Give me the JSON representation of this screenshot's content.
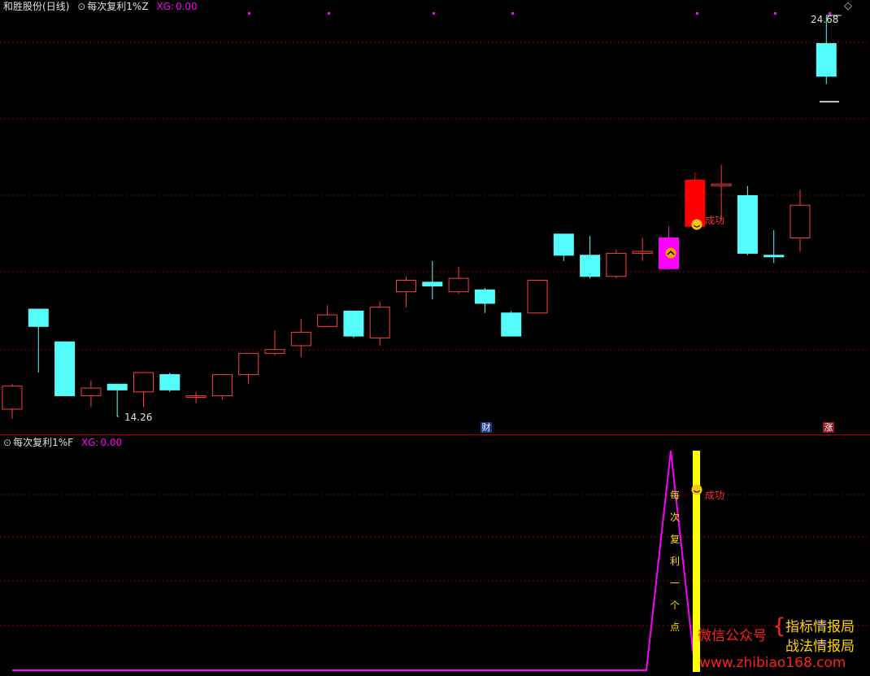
{
  "header": {
    "stock": "和胜股份",
    "period": "(日线)",
    "indicator": "每次复利1%Z",
    "xg_label": "XG:",
    "xg_value": "0.00"
  },
  "sub_header": {
    "indicator": "每次复利1%F",
    "xg_label": "XG:",
    "xg_value": "0.00"
  },
  "price_labels": {
    "high": "24.68",
    "low": "14.26"
  },
  "badges": {
    "cai": "财",
    "zhang": "涨"
  },
  "signals": {
    "success_main": "成功",
    "success_sub": "成功"
  },
  "vertical_text": [
    "每",
    "次",
    "复",
    "利",
    "一",
    "个",
    "点"
  ],
  "watermark": {
    "wechat": "微信公众号",
    "brace": "{",
    "name1": "指标情报局",
    "name2": "战法情报局",
    "url": "www.zhibiao168.com"
  },
  "colors": {
    "up": "#ff3c3c",
    "down": "#54fcfc",
    "grid": "#8c0000",
    "magenta": "#ff00ff",
    "yellow": "#ffff00",
    "signal_red": "#ff0000"
  },
  "chart_data": {
    "type": "candlestick",
    "y_high": 24.68,
    "y_low": 14.26,
    "candles": [
      {
        "o": 14.45,
        "h": 15.1,
        "l": 14.2,
        "c": 15.05,
        "color": "up"
      },
      {
        "o": 17.05,
        "h": 17.05,
        "l": 15.4,
        "c": 16.6,
        "color": "down"
      },
      {
        "o": 16.2,
        "h": 16.2,
        "l": 14.8,
        "c": 14.8,
        "color": "down"
      },
      {
        "o": 14.8,
        "h": 15.2,
        "l": 14.5,
        "c": 15.0,
        "color": "up"
      },
      {
        "o": 15.1,
        "h": 15.1,
        "l": 14.26,
        "c": 14.95,
        "color": "down"
      },
      {
        "o": 14.9,
        "h": 15.4,
        "l": 14.5,
        "c": 15.4,
        "color": "up"
      },
      {
        "o": 15.35,
        "h": 15.4,
        "l": 14.9,
        "c": 14.95,
        "color": "down"
      },
      {
        "o": 14.8,
        "h": 14.9,
        "l": 14.6,
        "c": 14.8,
        "color": "up"
      },
      {
        "o": 14.8,
        "h": 15.35,
        "l": 14.7,
        "c": 15.35,
        "color": "up"
      },
      {
        "o": 15.35,
        "h": 15.9,
        "l": 15.1,
        "c": 15.9,
        "color": "up"
      },
      {
        "o": 15.9,
        "h": 16.5,
        "l": 15.85,
        "c": 16.0,
        "color": "up"
      },
      {
        "o": 16.1,
        "h": 16.8,
        "l": 15.8,
        "c": 16.45,
        "color": "up"
      },
      {
        "o": 16.6,
        "h": 17.15,
        "l": 16.6,
        "c": 16.9,
        "color": "up"
      },
      {
        "o": 17.0,
        "h": 17.0,
        "l": 16.3,
        "c": 16.35,
        "color": "down"
      },
      {
        "o": 16.3,
        "h": 17.25,
        "l": 16.1,
        "c": 17.1,
        "color": "up"
      },
      {
        "o": 17.5,
        "h": 17.9,
        "l": 17.1,
        "c": 17.8,
        "color": "up"
      },
      {
        "o": 17.75,
        "h": 18.3,
        "l": 17.3,
        "c": 17.65,
        "color": "down"
      },
      {
        "o": 17.5,
        "h": 18.15,
        "l": 17.45,
        "c": 17.85,
        "color": "up"
      },
      {
        "o": 17.55,
        "h": 17.6,
        "l": 16.95,
        "c": 17.2,
        "color": "down"
      },
      {
        "o": 16.95,
        "h": 17.0,
        "l": 16.35,
        "c": 16.35,
        "color": "down"
      },
      {
        "o": 16.95,
        "h": 17.8,
        "l": 16.95,
        "c": 17.8,
        "color": "up"
      },
      {
        "o": 19.0,
        "h": 19.0,
        "l": 18.3,
        "c": 18.45,
        "color": "down"
      },
      {
        "o": 18.45,
        "h": 18.95,
        "l": 17.85,
        "c": 17.9,
        "color": "down"
      },
      {
        "o": 17.9,
        "h": 18.6,
        "l": 17.85,
        "c": 18.5,
        "color": "up"
      },
      {
        "o": 18.5,
        "h": 18.9,
        "l": 18.3,
        "c": 18.55,
        "color": "up"
      },
      {
        "o": 18.9,
        "h": 19.2,
        "l": 18.1,
        "c": 18.1,
        "color": "magenta"
      },
      {
        "o": 19.2,
        "h": 20.6,
        "l": 19.2,
        "c": 20.4,
        "color": "signal_red"
      },
      {
        "o": 20.3,
        "h": 20.8,
        "l": 19.35,
        "c": 20.3,
        "color": "up"
      },
      {
        "o": 20.0,
        "h": 20.25,
        "l": 18.45,
        "c": 18.5,
        "color": "down"
      },
      {
        "o": 18.45,
        "h": 19.1,
        "l": 18.25,
        "c": 18.45,
        "color": "down"
      },
      {
        "o": 18.9,
        "h": 20.15,
        "l": 18.55,
        "c": 19.75,
        "color": "up"
      },
      {
        "o": 23.95,
        "h": 24.68,
        "l": 22.9,
        "c": 23.1,
        "color": "down"
      }
    ],
    "indicator_xg": 0.0
  }
}
